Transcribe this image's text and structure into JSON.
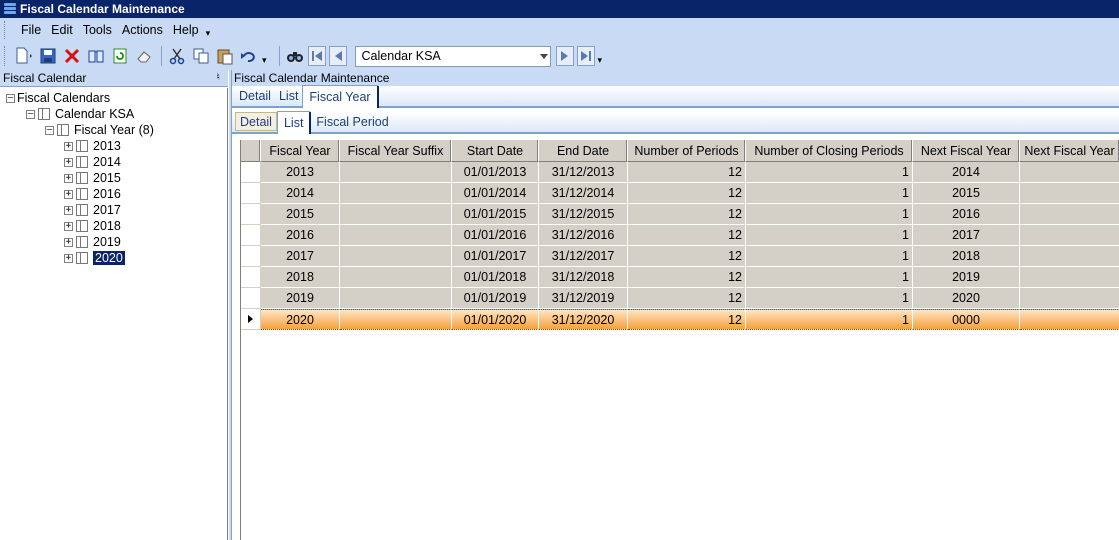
{
  "window": {
    "title": "Fiscal Calendar Maintenance"
  },
  "menu": {
    "items": [
      "File",
      "Edit",
      "Tools",
      "Actions",
      "Help"
    ]
  },
  "toolbar": {
    "buttons": [
      "new-icon",
      "save-icon",
      "delete-icon",
      "book-icon",
      "refresh-icon",
      "eraser-icon",
      "cut-icon",
      "copy-icon",
      "paste-icon",
      "undo-icon",
      "find-icon",
      "first-icon",
      "prev-icon",
      "next-icon",
      "last-icon"
    ],
    "calendar_value": "Calendar KSA"
  },
  "left_panel": {
    "title": "Fiscal Calendar",
    "tree": {
      "root": "Fiscal Calendars",
      "calendar": "Calendar KSA",
      "fiscal_year_node": "Fiscal Year (8)",
      "years": [
        "2013",
        "2014",
        "2015",
        "2016",
        "2017",
        "2018",
        "2019",
        "2020"
      ],
      "selected": "2020"
    }
  },
  "right_panel": {
    "title": "Fiscal Calendar Maintenance",
    "tabs_top": [
      "Detail",
      "List",
      "Fiscal Year"
    ],
    "tabs_top_active": "Fiscal Year",
    "tabs_sub": [
      "Detail",
      "List",
      "Fiscal Period"
    ],
    "tabs_sub_active": "List"
  },
  "grid": {
    "columns": [
      "Fiscal Year",
      "Fiscal Year Suffix",
      "Start Date",
      "End Date",
      "Number of Periods",
      "Number of Closing Periods",
      "Next Fiscal Year",
      "Next Fiscal Year"
    ],
    "rows": [
      [
        "2013",
        "",
        "01/01/2013",
        "31/12/2013",
        "12",
        "1",
        "2014",
        ""
      ],
      [
        "2014",
        "",
        "01/01/2014",
        "31/12/2014",
        "12",
        "1",
        "2015",
        ""
      ],
      [
        "2015",
        "",
        "01/01/2015",
        "31/12/2015",
        "12",
        "1",
        "2016",
        ""
      ],
      [
        "2016",
        "",
        "01/01/2016",
        "31/12/2016",
        "12",
        "1",
        "2017",
        ""
      ],
      [
        "2017",
        "",
        "01/01/2017",
        "31/12/2017",
        "12",
        "1",
        "2018",
        ""
      ],
      [
        "2018",
        "",
        "01/01/2018",
        "31/12/2018",
        "12",
        "1",
        "2019",
        ""
      ],
      [
        "2019",
        "",
        "01/01/2019",
        "31/12/2019",
        "12",
        "1",
        "2020",
        ""
      ],
      [
        "2020",
        "",
        "01/01/2020",
        "31/12/2020",
        "12",
        "1",
        "0000",
        ""
      ]
    ],
    "selected_row": 7
  },
  "colors": {
    "title_bar": "#0a246a",
    "chrome": "#c9daf4",
    "selection": "#f7a13a",
    "grid_cell": "#d4d0c8"
  }
}
